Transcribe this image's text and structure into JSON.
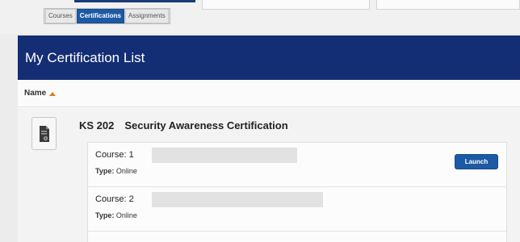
{
  "tabs": [
    {
      "label": "Courses"
    },
    {
      "label": "Certifications"
    },
    {
      "label": "Assignments"
    }
  ],
  "panel": {
    "title": "My Certification List",
    "column_header": "Name"
  },
  "certification": {
    "title": "KS 202 Security Awareness Certification",
    "courses": [
      {
        "label": "Course: 1",
        "type_label": "Type:",
        "type_value": "Online",
        "action_label": "Launch"
      },
      {
        "label": "Course: 2",
        "type_label": "Type:",
        "type_value": "Online"
      }
    ]
  },
  "colors": {
    "header_bg": "#142e75",
    "accent": "#1d5aa6",
    "sort_arrow": "#e07b1a"
  },
  "icons": {
    "sort": "sort-ascending-icon",
    "certificate": "document-certificate-icon"
  }
}
